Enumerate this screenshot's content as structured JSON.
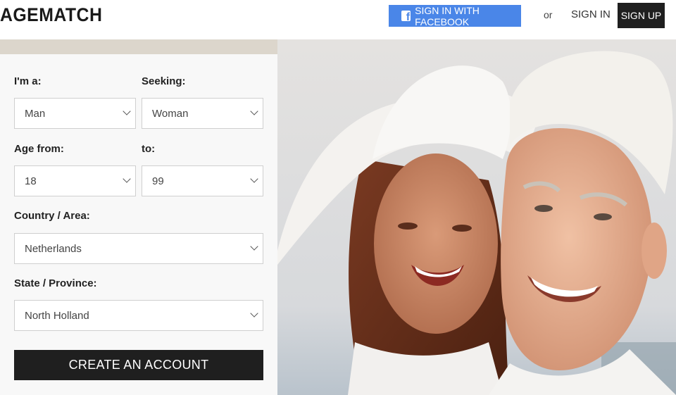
{
  "header": {
    "logo": "AGEMATCH",
    "facebook_button": "SIGN IN WITH FACEBOOK",
    "or_text": "or",
    "sign_in": "SIGN IN",
    "sign_up": "SIGN UP"
  },
  "form": {
    "im_a_label": "I'm a:",
    "im_a_value": "Man",
    "seeking_label": "Seeking:",
    "seeking_value": "Woman",
    "age_from_label": "Age from:",
    "age_from_value": "18",
    "age_to_label": "to:",
    "age_to_value": "99",
    "country_label": "Country / Area:",
    "country_value": "Netherlands",
    "state_label": "State / Province:",
    "state_value": "North Holland",
    "create_button": "CREATE AN ACCOUNT"
  },
  "colors": {
    "facebook_blue": "#4a86e8",
    "dark_button": "#1f1f1f",
    "panel_bg": "#f8f8f8"
  },
  "icons": [
    "facebook-icon",
    "chevron-down-icon"
  ]
}
